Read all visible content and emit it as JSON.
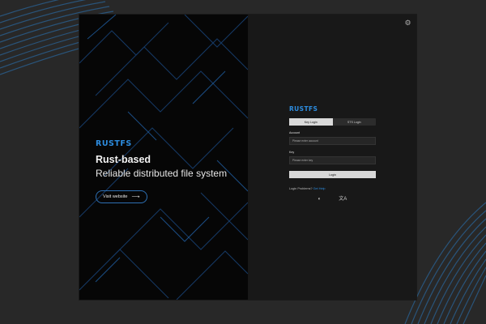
{
  "hero": {
    "logo_text": "RUSTFS",
    "title": "Rust-based",
    "subtitle": "Reliable distributed file system",
    "visit_label": "Visit website",
    "visit_arrow": "⟶"
  },
  "settings": {
    "icon": "⚙"
  },
  "login": {
    "logo_text": "RUSTFS",
    "tabs": [
      {
        "label": "Key Login",
        "active": true
      },
      {
        "label": "STS Login",
        "active": false
      }
    ],
    "account_label": "Account",
    "account_placeholder": "Please enter account",
    "key_label": "Key",
    "key_placeholder": "Please enter key",
    "login_button": "Login",
    "problems_text": "Login Problems?",
    "help_link": "Get Help",
    "theme_icon": "◐",
    "language_icon": "文A"
  }
}
